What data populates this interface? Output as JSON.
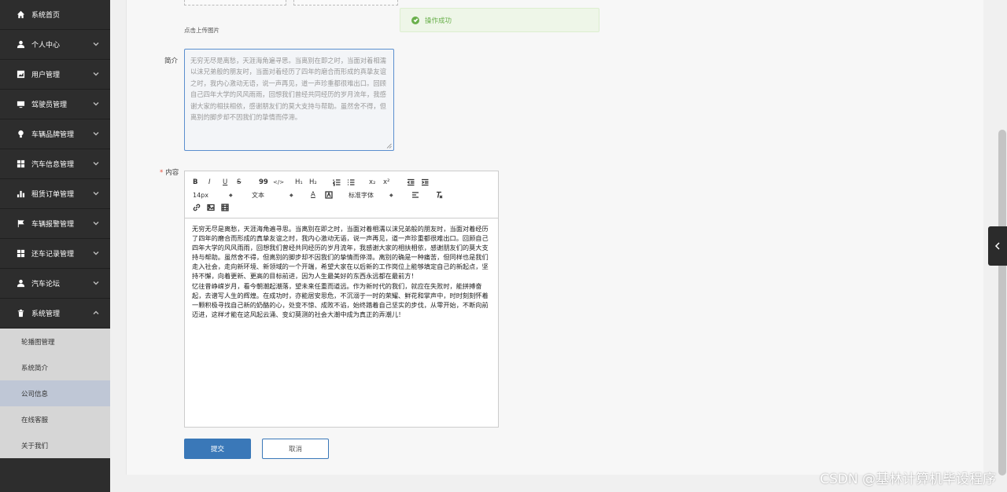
{
  "sidebar": {
    "items": [
      {
        "label": "系统首页",
        "icon": "home-icon",
        "expandable": false
      },
      {
        "label": "个人中心",
        "icon": "user-icon",
        "expandable": true
      },
      {
        "label": "用户管理",
        "icon": "chart-icon",
        "expandable": true
      },
      {
        "label": "驾驶员管理",
        "icon": "monitor-icon",
        "expandable": true
      },
      {
        "label": "车辆品牌管理",
        "icon": "bulb-icon",
        "expandable": true
      },
      {
        "label": "汽车信息管理",
        "icon": "grid-icon",
        "expandable": true
      },
      {
        "label": "租赁订单管理",
        "icon": "bar-chart-icon",
        "expandable": true
      },
      {
        "label": "车辆报警管理",
        "icon": "flag-icon",
        "expandable": true
      },
      {
        "label": "还车记录管理",
        "icon": "grid-icon",
        "expandable": true
      },
      {
        "label": "汽车论坛",
        "icon": "user-icon",
        "expandable": true
      },
      {
        "label": "系统管理",
        "icon": "trash-icon",
        "expandable": true,
        "expanded": true
      }
    ],
    "sub_items": [
      {
        "label": "轮播图管理"
      },
      {
        "label": "系统简介"
      },
      {
        "label": "公司信息",
        "active": true
      },
      {
        "label": "在线客服"
      },
      {
        "label": "关于我们"
      }
    ]
  },
  "form": {
    "upload_hint": "点击上传图片",
    "intro_label": "简介",
    "intro_text": "无穷无尽是离愁，天涯海角遍寻思。当离别在即之时，当面对着相濡以沫兄弟般的朋友时，当面对着经历了四年的磨合而形成的真挚友谊之时，我内心激动无语，说一声再见，道一声珍重都很难出口。回顾自己四年大学的风风雨雨，回想我们曾经共同经历的岁月流年，我感谢大家的相扶相依，感谢朋友们的莫大支持与帮助。虽然舍不得，但离别的脚步却不因我们的挚情而停滞。",
    "content_label": "内容",
    "content_required_mark": "*",
    "content_text_1": "无穷无尽是离愁，天涯海角遍寻思。当离别在即之时，当面对着相濡以沫兄弟般的朋友时，当面对着经历了四年的磨合而形成的真挚友谊之时，我内心激动无语，说一声再见，道一声珍重都很难出口。回顾自己四年大学的风风雨雨，回想我们曾经共同经历的岁月流年，我感谢大家的相扶相依，感谢朋友们的莫大支持与帮助。虽然舍不得，但离别的脚步却不因我们的挚情而停滞。离别的确是一种痛苦，但同样也是我们走入社会，走向新环境、新领域的一个开端，希望大家在以后新的工作岗位上能够填定自己的新起点，坚持不懈，向着更新、更高的目标前进，因为人生最美好的东西永远都在最前方！",
    "content_text_2": "忆往昔峥嵘岁月，看今朝潮起潮落，望未来任重而道远。作为新时代的我们，就应在失败时，能拼搏奋起，去谱写人生的辉煌。在成功时，亦能居安思危，不沉溺于一时的荣耀、鲜花和掌声中，时时刻刻怀着一颗积极寻找自己新的奶酪的心，处变不惊、成败不谄，始终踏着自己坚实的步伐，从零开始，不断向前迈进，这样才能在这风起云涌、变幻莫测的社会大潮中成为真正的弄潮儿！",
    "toolbar": {
      "size_value": "14px",
      "header_value": "文本",
      "font_value": "标准字体",
      "h1": "H₁",
      "h2": "H₂",
      "sub": "x₂",
      "sup": "x²",
      "bold": "B",
      "italic": "I",
      "underline": "U",
      "strike": "S",
      "quote": "99",
      "code": "</>",
      "font_color": "A"
    },
    "submit_label": "提交",
    "cancel_label": "取消"
  },
  "toast": {
    "message": "操作成功"
  },
  "watermark": "CSDN @基林计算机毕设程序"
}
